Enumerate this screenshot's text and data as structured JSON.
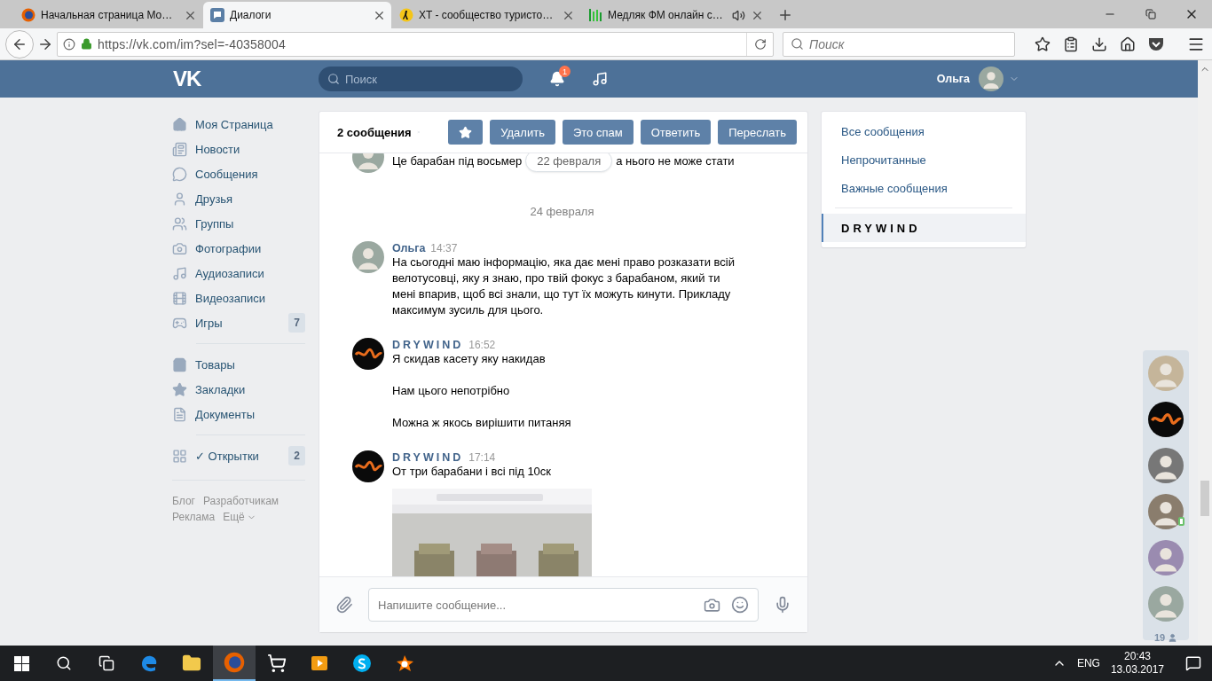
{
  "browser": {
    "tabs": [
      {
        "title": "Начальная страница Мо…",
        "selected": false,
        "audio": false
      },
      {
        "title": "Диалоги",
        "selected": true,
        "audio": false
      },
      {
        "title": "XT - сообщество туристо…",
        "selected": false,
        "audio": false
      },
      {
        "title": "Медляк ФМ онлайн с…",
        "selected": false,
        "audio": true
      }
    ],
    "url": "https://vk.com/im?sel=-40358004",
    "search_placeholder": "Поиск"
  },
  "vk_header": {
    "logo": "VK",
    "search_placeholder": "Поиск",
    "notifications": "1",
    "user": "Ольга"
  },
  "sidebar": {
    "sections": [
      [
        {
          "label": "Моя Страница"
        },
        {
          "label": "Новости"
        },
        {
          "label": "Сообщения"
        },
        {
          "label": "Друзья"
        },
        {
          "label": "Группы"
        },
        {
          "label": "Фотографии"
        },
        {
          "label": "Аудиозаписи"
        },
        {
          "label": "Видеозаписи"
        },
        {
          "label": "Игры",
          "count": "7"
        }
      ],
      [
        {
          "label": "Товары"
        },
        {
          "label": "Закладки"
        },
        {
          "label": "Документы"
        }
      ],
      [
        {
          "label": "✓ Открытки",
          "count": "2"
        }
      ]
    ],
    "footer_links": [
      "Блог",
      "Разработчикам",
      "Реклама",
      "Ещё"
    ]
  },
  "dialog": {
    "selection": "2 сообщения",
    "buttons": [
      "Удалить",
      "Это спам",
      "Ответить",
      "Переслать"
    ],
    "floating_date": "22 февраля",
    "messages": [
      {
        "kind": "partial",
        "text_before": "Це барабан під восьмер",
        "text_after": "а нього не може стати"
      },
      {
        "kind": "date",
        "text": "24 февраля"
      },
      {
        "kind": "user",
        "author": "Ольга",
        "time": "14:37",
        "lines": [
          "На сьогодні маю інформацію, яка дає мені право розказати всій велотусовці, яку я знаю, про твій фокус з барабаном, який ти мені впарив, щоб всі знали, що тут їх можуть кинути. Прикладу максимум зусиль для цього."
        ]
      },
      {
        "kind": "community",
        "author": "DRYWIND",
        "time": "16:52",
        "lines": [
          "Я скидав касету яку накидав",
          "Нам цього непотрібно",
          "Можна ж якось вирішити питаняя"
        ]
      },
      {
        "kind": "community",
        "author": "DRYWIND",
        "time": "17:14",
        "lines": [
          "От три барабани і всі під 10ск"
        ]
      }
    ],
    "input_placeholder": "Напишите сообщение..."
  },
  "filters": [
    {
      "label": "Все сообщения",
      "kind": "filter",
      "selected": false
    },
    {
      "label": "Непрочитанные",
      "kind": "filter",
      "selected": false
    },
    {
      "label": "Важные сообщения",
      "kind": "filter",
      "selected": false
    },
    {
      "label": "DRYWIND",
      "kind": "conversation",
      "selected": true
    }
  ],
  "friends": {
    "items": [
      {
        "online": false
      },
      {
        "online": false
      },
      {
        "online": false
      },
      {
        "online": true
      },
      {
        "online": false
      },
      {
        "online": false
      }
    ],
    "count": "19"
  },
  "taskbar": {
    "apps": [
      {
        "selected": false
      },
      {
        "selected": false
      },
      {
        "selected": true
      },
      {
        "selected": false
      },
      {
        "selected": false
      },
      {
        "selected": false
      },
      {
        "selected": false
      }
    ],
    "language": "ENG",
    "time": "20:43",
    "date": "13.03.2017"
  }
}
